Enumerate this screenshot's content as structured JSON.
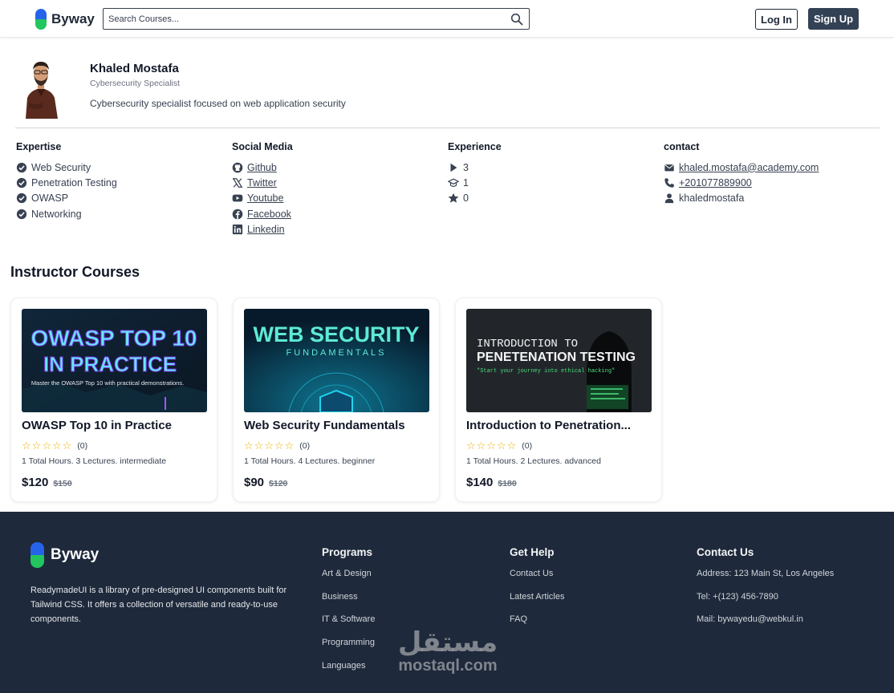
{
  "brand": {
    "name": "Byway",
    "blue": "#2563eb",
    "green": "#22c55e"
  },
  "header": {
    "search_placeholder": "Search Courses...",
    "login_label": "Log In",
    "signup_label": "Sign Up"
  },
  "profile": {
    "name": "Khaled Mostafa",
    "title": "Cybersecurity Specialist",
    "bio": "Cybersecurity specialist focused on web application security"
  },
  "details": {
    "expertise": {
      "heading": "Expertise",
      "items": [
        "Web Security",
        "Penetration Testing",
        "OWASP",
        "Networking"
      ]
    },
    "social": {
      "heading": "Social Media",
      "items": [
        "Github",
        "Twitter",
        "Youtube",
        "Facebook",
        "Linkedin"
      ]
    },
    "experience": {
      "heading": "Experience",
      "items": [
        "3",
        "1",
        "0"
      ]
    },
    "contact": {
      "heading": "contact",
      "email": "khaled.mostafa@academy.com",
      "phone": "+201077889900",
      "username": "khaledmostafa"
    }
  },
  "courses_section": {
    "title": "Instructor Courses",
    "courses": [
      {
        "title": "OWASP Top 10 in Practice",
        "thumb_line1": "OWASP TOP 10",
        "thumb_line2": "IN PRACTICE",
        "thumb_sub": "Master the OWASP Top 10 with practical demonstrations.",
        "rating_count": "(0)",
        "meta": "1 Total Hours. 3 Lectures. intermediate",
        "price": "$120",
        "old_price": "$150"
      },
      {
        "title": "Web Security Fundamentals",
        "thumb_line1": "WEB SECURITY",
        "thumb_line2": "FUNDAMENTALS",
        "rating_count": "(0)",
        "meta": "1 Total Hours. 4 Lectures. beginner",
        "price": "$90",
        "old_price": "$120"
      },
      {
        "title": "Introduction to Penetration...",
        "thumb_line1": "INTRODUCTION TO",
        "thumb_line2": "PENETENATION TESTING",
        "thumb_sub": "\"Start your journey into ethical hacking\"",
        "rating_count": "(0)",
        "meta": "1 Total Hours. 2 Lectures. advanced",
        "price": "$140",
        "old_price": "$180"
      }
    ]
  },
  "footer": {
    "brand": "Byway",
    "description": "ReadymadeUI is a library of pre-designed UI components built for Tailwind CSS. It offers a collection of versatile and ready-to-use components.",
    "programs": {
      "heading": "Programs",
      "items": [
        "Art & Design",
        "Business",
        "IT & Software",
        "Programming",
        "Languages"
      ]
    },
    "help": {
      "heading": "Get Help",
      "items": [
        "Contact Us",
        "Latest Articles",
        "FAQ"
      ]
    },
    "contact": {
      "heading": "Contact Us",
      "items": [
        "Address: 123 Main St, Los Angeles",
        "Tel: +(123) 456-7890",
        "Mail: bywayedu@webkul.in"
      ]
    }
  },
  "watermark": {
    "arabic": "مستقل",
    "latin": "mostaql.com"
  }
}
